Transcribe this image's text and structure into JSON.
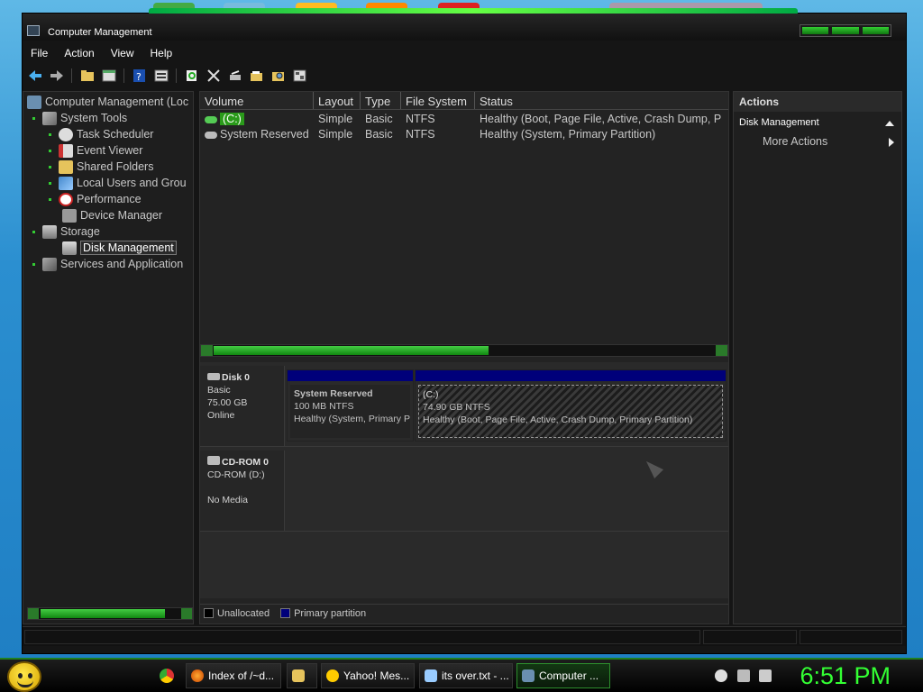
{
  "window": {
    "title": "Computer Management"
  },
  "menu": [
    "File",
    "Action",
    "View",
    "Help"
  ],
  "toolbar": {
    "icons": [
      "back-arrow-icon",
      "forward-arrow-icon",
      "up-folder-icon",
      "show-hide-tree-icon",
      "help-icon",
      "properties-icon",
      "refresh-icon",
      "delete-icon",
      "rescan-icon",
      "open-icon",
      "search-icon",
      "export-icon"
    ]
  },
  "tree": {
    "root": "Computer Management (Loc",
    "system_tools": "System Tools",
    "task_scheduler": "Task Scheduler",
    "event_viewer": "Event Viewer",
    "shared_folders": "Shared Folders",
    "local_users": "Local Users and Grou",
    "performance": "Performance",
    "device_manager": "Device Manager",
    "storage": "Storage",
    "disk_management": "Disk Management",
    "services": "Services and Application"
  },
  "volumes": {
    "headers": [
      "Volume",
      "Layout",
      "Type",
      "File System",
      "Status"
    ],
    "rows": [
      {
        "volume": "(C:)",
        "layout": "Simple",
        "type": "Basic",
        "fs": "NTFS",
        "status": "Healthy (Boot, Page File, Active, Crash Dump, P"
      },
      {
        "volume": "System Reserved",
        "layout": "Simple",
        "type": "Basic",
        "fs": "NTFS",
        "status": "Healthy (System, Primary Partition)"
      }
    ]
  },
  "disks": {
    "disk0": {
      "name": "Disk 0",
      "type": "Basic",
      "size": "75.00 GB",
      "state": "Online"
    },
    "sysres": {
      "title": "System Reserved",
      "size": "100 MB NTFS",
      "status": "Healthy (System, Primary P"
    },
    "c": {
      "title": "(C:)",
      "size": "74.90 GB NTFS",
      "status": "Healthy (Boot, Page File, Active, Crash Dump, Primary Partition)"
    },
    "cdrom": {
      "name": "CD-ROM 0",
      "drive": "CD-ROM (D:)",
      "media": "No Media"
    }
  },
  "legend": {
    "unallocated": "Unallocated",
    "primary": "Primary partition"
  },
  "colors": {
    "unallocated": "#000000",
    "primary": "#00007a",
    "accent": "#33dd33"
  },
  "actions": {
    "header": "Actions",
    "section": "Disk Management",
    "more": "More Actions"
  },
  "taskbar": {
    "tasks": [
      "Index of /~d...",
      "",
      "Yahoo! Mes...",
      "its over.txt - ...",
      "Computer ..."
    ],
    "clock": "6:51 PM"
  }
}
